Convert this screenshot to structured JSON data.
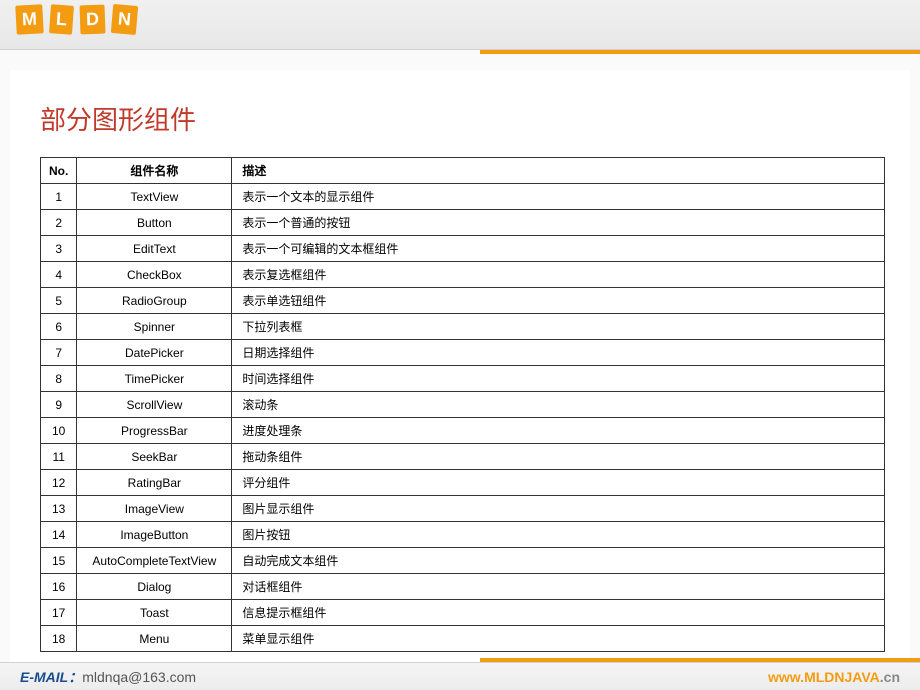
{
  "logo": {
    "letters": [
      "M",
      "L",
      "D",
      "N"
    ]
  },
  "title": "部分图形组件",
  "table": {
    "headers": {
      "no": "No.",
      "name": "组件名称",
      "desc": "描述"
    },
    "rows": [
      {
        "no": "1",
        "name": "TextView",
        "desc": "表示一个文本的显示组件"
      },
      {
        "no": "2",
        "name": "Button",
        "desc": "表示一个普通的按钮"
      },
      {
        "no": "3",
        "name": "EditText",
        "desc": "表示一个可编辑的文本框组件"
      },
      {
        "no": "4",
        "name": "CheckBox",
        "desc": "表示复选框组件"
      },
      {
        "no": "5",
        "name": "RadioGroup",
        "desc": "表示单选钮组件"
      },
      {
        "no": "6",
        "name": "Spinner",
        "desc": "下拉列表框"
      },
      {
        "no": "7",
        "name": "DatePicker",
        "desc": "日期选择组件"
      },
      {
        "no": "8",
        "name": "TimePicker",
        "desc": "时间选择组件"
      },
      {
        "no": "9",
        "name": "ScrollView",
        "desc": "滚动条"
      },
      {
        "no": "10",
        "name": "ProgressBar",
        "desc": "进度处理条"
      },
      {
        "no": "11",
        "name": "SeekBar",
        "desc": "拖动条组件"
      },
      {
        "no": "12",
        "name": "RatingBar",
        "desc": "评分组件"
      },
      {
        "no": "13",
        "name": "ImageView",
        "desc": "图片显示组件"
      },
      {
        "no": "14",
        "name": "ImageButton",
        "desc": "图片按钮"
      },
      {
        "no": "15",
        "name": "AutoCompleteTextView",
        "desc": "自动完成文本组件"
      },
      {
        "no": "16",
        "name": "Dialog",
        "desc": "对话框组件"
      },
      {
        "no": "17",
        "name": "Toast",
        "desc": "信息提示框组件"
      },
      {
        "no": "18",
        "name": "Menu",
        "desc": "菜单显示组件"
      }
    ]
  },
  "footer": {
    "emailLabel": "E-MAIL：",
    "email": "mldnqa@163.com",
    "urlPrefix": "www.",
    "urlDomain": "MLDNJAVA",
    "urlSuffix": ".cn"
  }
}
